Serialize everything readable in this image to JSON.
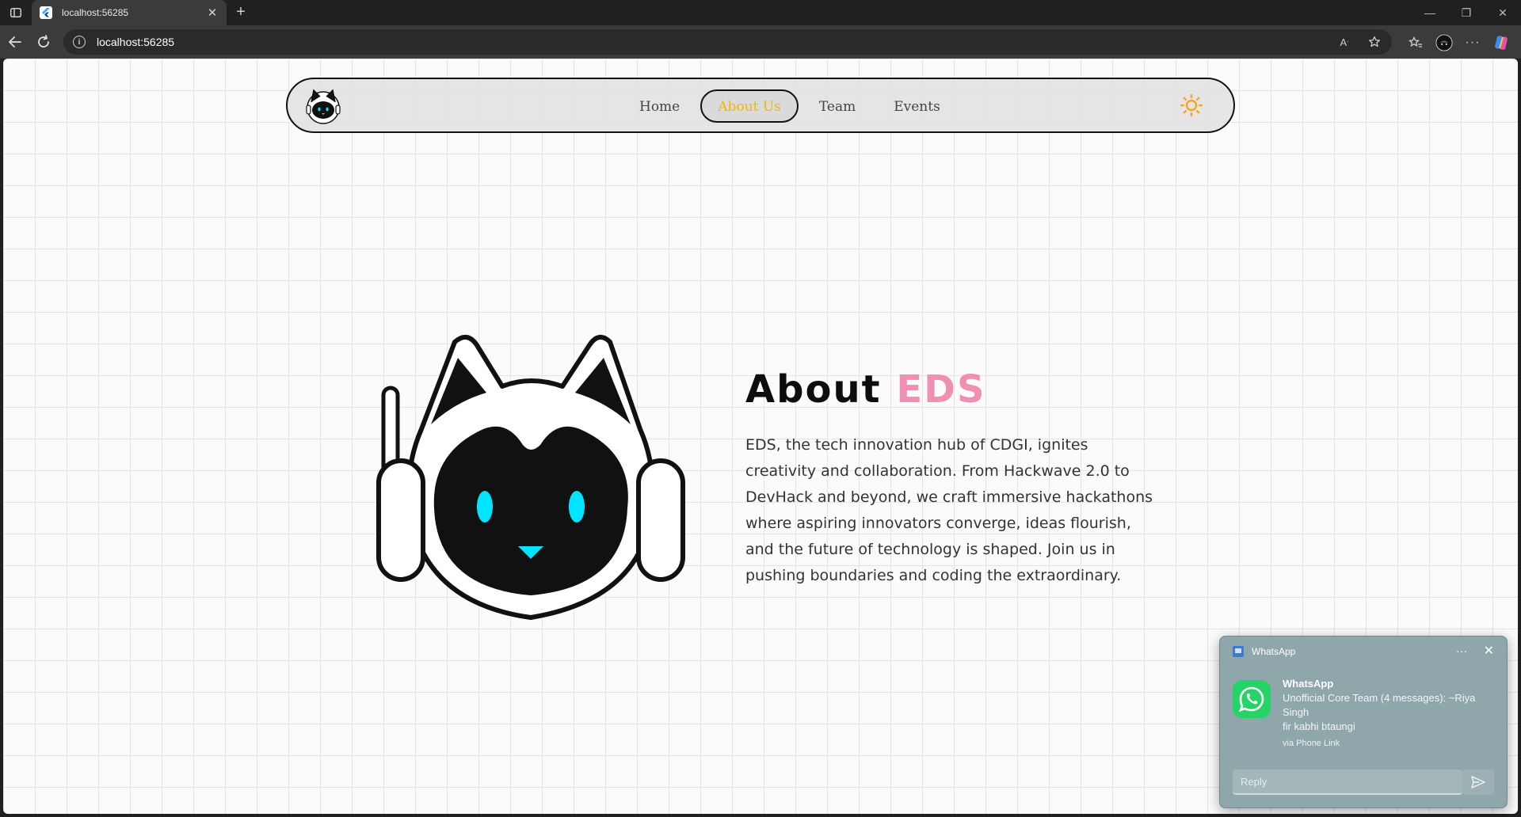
{
  "browser": {
    "tab_title": "localhost:56285",
    "tab_close": "✕",
    "new_tab": "+",
    "url": "localhost:56285",
    "window_controls": {
      "minimize": "—",
      "restore": "❐",
      "close": "✕"
    },
    "icons": [
      "sidebar-icon",
      "flutter-favicon",
      "back-icon",
      "refresh-icon",
      "info-icon",
      "read-aloud-icon",
      "favorite-star-icon",
      "favorites-icon",
      "profile-avatar",
      "more-icon",
      "copilot-icon"
    ]
  },
  "site": {
    "nav": {
      "items": [
        {
          "label": "Home"
        },
        {
          "label": "About Us",
          "active": true
        },
        {
          "label": "Team"
        },
        {
          "label": "Events"
        }
      ],
      "active_color": "#f2b705"
    },
    "about": {
      "title_prefix": "About",
      "title_accent": "EDS",
      "accent_color": "#ef8fb1",
      "body": "EDS, the tech innovation hub of CDGI, ignites creativity and collaboration. From Hackwave 2.0 to DevHack and beyond, we craft immersive hackathons where aspiring innovators converge, ideas flourish, and the future of technology is shaped. Join us in pushing boundaries and coding the extraordinary."
    }
  },
  "notification": {
    "app_name": "WhatsApp",
    "more": "···",
    "close": "✕",
    "title": "WhatsApp",
    "message_line1": "Unofficial Core Team (4 messages): ~Riya Singh",
    "message_line2": "fir kabhi btaungi",
    "via": "via Phone Link",
    "reply_placeholder": "Reply"
  }
}
